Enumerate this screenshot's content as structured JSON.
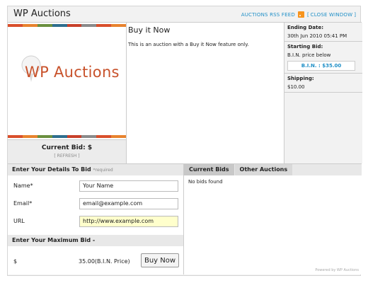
{
  "window": {
    "title": "WP Auctions",
    "rss_link": "AUCTIONS RSS FEED",
    "close_link": "CLOSE WINDOW",
    "bracket_open": "[",
    "bracket_close": "]"
  },
  "image": {
    "logo_text": "WP Auctions",
    "stripe_colors": [
      "#d94f2b",
      "#e8832e",
      "#6a8f3f",
      "#2e6e8e",
      "#c8402a",
      "#8a8a8a",
      "#d94f2b",
      "#e8832e"
    ]
  },
  "bid_panel": {
    "current_bid": "Current Bid: $",
    "refresh": "[ REFRESH ]"
  },
  "item": {
    "title": "Buy it Now",
    "description": "This is an auction with a Buy it Now feature only."
  },
  "info": {
    "ending_label": "Ending Date:",
    "ending_value": "30th Jun 2010 05:41 PM",
    "starting_label": "Starting Bid:",
    "starting_value": "B.I.N. price below",
    "bin_button": "B.I.N. : $35.00",
    "shipping_label": "Shipping:",
    "shipping_value": "$10.00"
  },
  "details_form": {
    "header": "Enter Your Details To Bid",
    "required": "*required",
    "name_label": "Name*",
    "name_value": "Your Name",
    "email_label": "Email*",
    "email_value": "email@example.com",
    "url_label": "URL",
    "url_value": "http://www.example.com"
  },
  "max_bid": {
    "header": "Enter Your Maximum Bid -",
    "currency": "$",
    "bin_price": "35.00(B.I.N. Price)",
    "buy_now": "Buy Now"
  },
  "tabs": {
    "current_bids": "Current Bids",
    "other_auctions": "Other Auctions",
    "no_bids": "No bids found"
  },
  "footer": {
    "powered": "Powered by WP Auctions"
  },
  "colors": {
    "link": "#1f8fc7",
    "logo": "#c8522b",
    "rss": "#f7941d",
    "url_field_bg": "#ffffcc"
  },
  "icons": [
    "rss-icon",
    "logo-pin-icon"
  ]
}
